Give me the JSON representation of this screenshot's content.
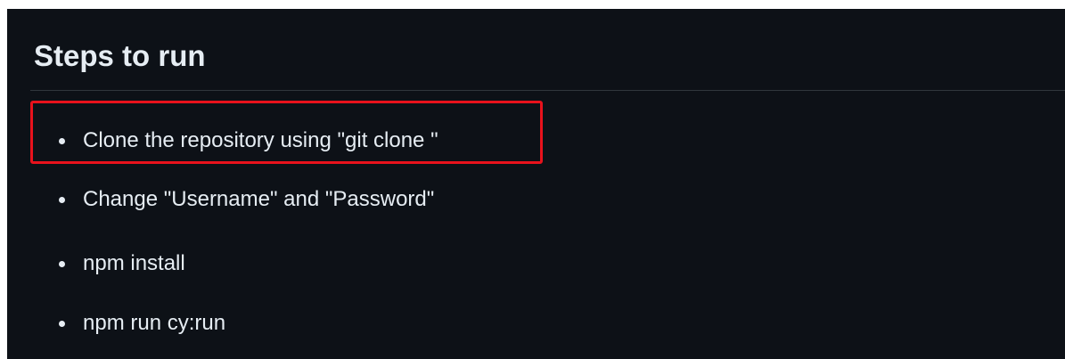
{
  "readme": {
    "heading": "Steps to run",
    "steps": [
      {
        "text": "Clone the repository using \"git clone \""
      },
      {
        "text": "Change \"Username\" and \"Password\""
      },
      {
        "text": "npm install"
      },
      {
        "text": "npm run cy:run"
      }
    ]
  },
  "annotation": {
    "color": "#e8121c",
    "target_step": 1
  },
  "colors": {
    "background": "#0d1117",
    "text": "#e6edf3",
    "divider": "#30363d"
  }
}
